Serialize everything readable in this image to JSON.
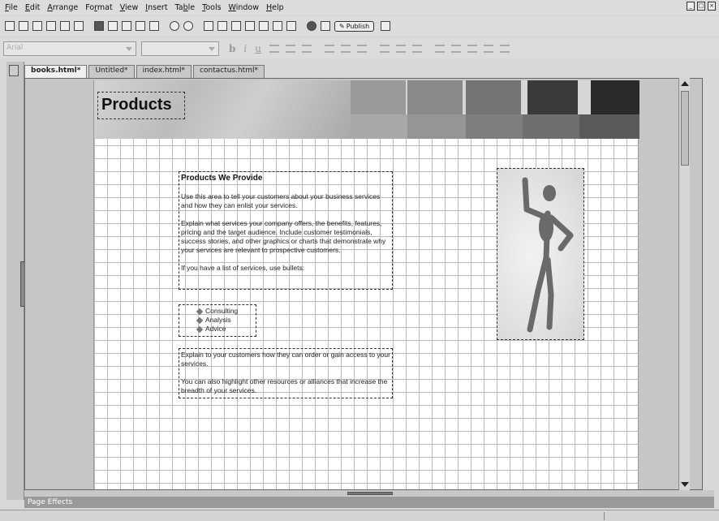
{
  "menu": [
    "File",
    "Edit",
    "Arrange",
    "Format",
    "View",
    "Insert",
    "Table",
    "Tools",
    "Window",
    "Help"
  ],
  "menu_mnemonics": [
    "F",
    "E",
    "A",
    "r",
    "V",
    "I",
    "b",
    "T",
    "W",
    "H"
  ],
  "toolbar": {
    "publish_label": "Publish"
  },
  "format_bar": {
    "font_value": "Arial",
    "bold": "b",
    "italic": "i",
    "underline": "u"
  },
  "tabs": [
    "books.html*",
    "Untitled*",
    "index.html*",
    "contactus.html*"
  ],
  "page": {
    "title": "Products",
    "swatch_colors_top": [
      "#9a9a9a",
      "#8a8a8a",
      "#747474",
      "#3a3a3a",
      "#2a2a2a"
    ],
    "swatch_colors_bottom": [
      "#a8a8a8",
      "#959595",
      "#7e7e7e",
      "#6e6e6e",
      "#5a5a5a"
    ],
    "content": {
      "heading": "Products We Provide",
      "p1": "Use this area to tell your customers about your business services and how they can enlist your services.",
      "p2": "Explain what services your company offers, the benefits, features, pricing and the target audience. Include customer testimonials, success stories, and other graphics or charts that demonstrate why your services are relevant to prospective customers.",
      "p3": "If you have a list of services, use bullets:"
    },
    "services": [
      "Consulting",
      "Analysis",
      "Advice"
    ],
    "footer_text": {
      "p1": "Explain to your customers how they can order or gain access to your services.",
      "p2": "You can also highlight other resources or alliances that increase the breadth of your services."
    }
  },
  "bottom_panel": {
    "label": "Page Effects"
  }
}
